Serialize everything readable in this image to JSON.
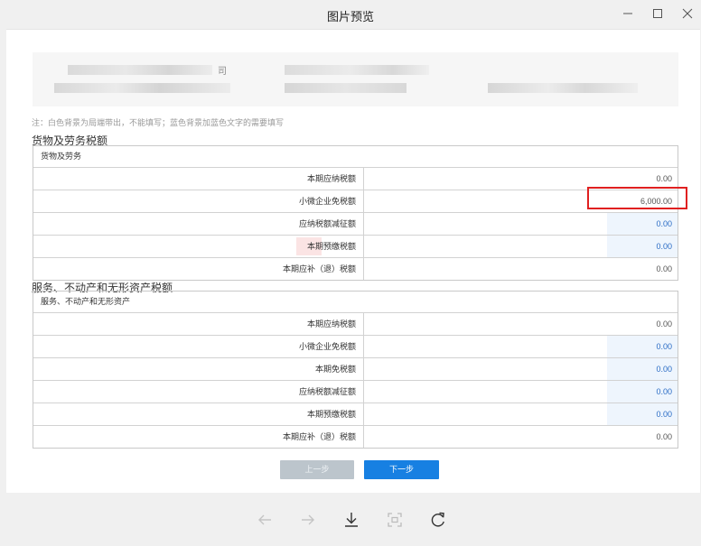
{
  "window": {
    "title": "图片预览"
  },
  "header_block": {
    "visible_char": "司"
  },
  "note": "注：白色背景为局端带出，不能填写；蓝色背景加蓝色文字的需要填写",
  "section_goods": {
    "title": "货物及劳务税额",
    "table_header": "货物及劳务",
    "rows": [
      {
        "label": "本期应纳税额",
        "value": "0.00"
      },
      {
        "label": "小微企业免税额",
        "value": "6,000.00"
      },
      {
        "label": "应纳税额减征额",
        "value": "0.00"
      },
      {
        "label": "本期预缴税额",
        "value": "0.00"
      },
      {
        "label": "本期应补（退）税额",
        "value": "0.00"
      }
    ]
  },
  "section_services": {
    "title": "服务、不动产和无形资产税额",
    "table_header": "服务、不动产和无形资产",
    "rows": [
      {
        "label": "本期应纳税额",
        "value": "0.00"
      },
      {
        "label": "小微企业免税额",
        "value": "0.00"
      },
      {
        "label": "本期免税额",
        "value": "0.00"
      },
      {
        "label": "应纳税额减征额",
        "value": "0.00"
      },
      {
        "label": "本期预缴税额",
        "value": "0.00"
      },
      {
        "label": "本期应补（退）税额",
        "value": "0.00"
      }
    ]
  },
  "buttons": {
    "prev": "上一步",
    "next": "下一步"
  },
  "colors": {
    "accent": "#1780e2",
    "highlight_box": "#e02020",
    "editable_bg": "#eef5fd",
    "editable_text": "#2a6cc5"
  },
  "toolbar_icons": [
    "arrow-left-icon",
    "arrow-right-icon",
    "download-icon",
    "fit-screen-icon",
    "rotate-icon"
  ]
}
